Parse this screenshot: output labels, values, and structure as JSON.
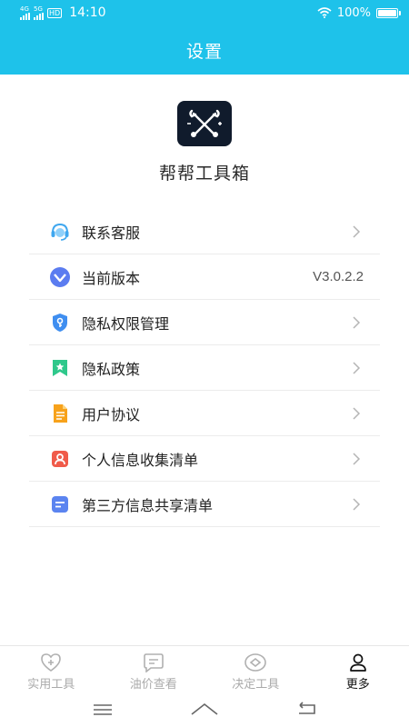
{
  "status_bar": {
    "signal_1": "4G",
    "signal_2": "5G",
    "hd": "HD",
    "time": "14:10",
    "battery": "100%"
  },
  "header": {
    "title": "设置"
  },
  "app": {
    "name": "帮帮工具箱",
    "logo_icon": "wrench-screwdriver-icon"
  },
  "menu": [
    {
      "label": "联系客服",
      "icon": "customer-service-icon"
    },
    {
      "label": "当前版本",
      "icon": "version-icon",
      "value": "V3.0.2.2"
    },
    {
      "label": "隐私权限管理",
      "icon": "shield-key-icon"
    },
    {
      "label": "隐私政策",
      "icon": "bookmark-star-icon"
    },
    {
      "label": "用户协议",
      "icon": "document-icon"
    },
    {
      "label": "个人信息收集清单",
      "icon": "person-icon"
    },
    {
      "label": "第三方信息共享清单",
      "icon": "list-icon"
    }
  ],
  "tabs": [
    {
      "label": "实用工具",
      "icon": "heart-plus-icon",
      "active": false
    },
    {
      "label": "油价查看",
      "icon": "message-icon",
      "active": false
    },
    {
      "label": "决定工具",
      "icon": "eye-icon",
      "active": false
    },
    {
      "label": "更多",
      "icon": "user-icon",
      "active": true
    }
  ],
  "colors": {
    "accent": "#1ec2ea",
    "logo_bg": "#101b2c",
    "tab_inactive": "#aaaaaa",
    "tab_active": "#111111"
  }
}
